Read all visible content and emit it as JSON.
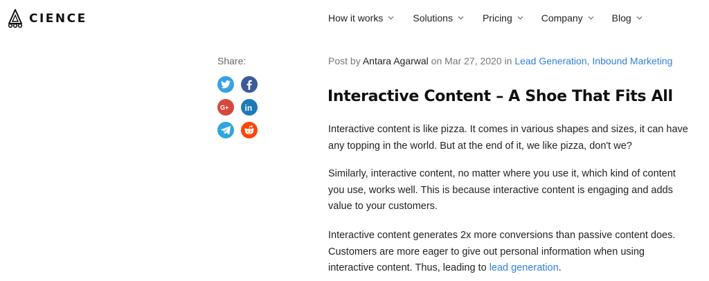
{
  "header": {
    "brand": "CIENCE",
    "nav": [
      {
        "label": "How it works"
      },
      {
        "label": "Solutions"
      },
      {
        "label": "Pricing"
      },
      {
        "label": "Company"
      },
      {
        "label": "Blog"
      }
    ]
  },
  "share": {
    "label": "Share:",
    "buttons": [
      {
        "name": "twitter",
        "color": "#3aa1e2"
      },
      {
        "name": "facebook",
        "color": "#3a5a98"
      },
      {
        "name": "google-plus",
        "color": "#d5493c"
      },
      {
        "name": "linkedin",
        "color": "#1d7ab8"
      },
      {
        "name": "telegram",
        "color": "#30a6dc"
      },
      {
        "name": "reddit",
        "color": "#fe4500"
      }
    ]
  },
  "post": {
    "meta_prefix": "Post by",
    "author": "Antara Agarwal",
    "meta_on": "on Mar 27, 2020 in",
    "category1": "Lead Generation",
    "separator": ",",
    "category2": "Inbound Marketing",
    "title": "Interactive Content – A Shoe That Fits All",
    "paragraph1": "Interactive content is like pizza. It comes in various shapes and sizes, it can have any topping in the world. But at the end of it, we like pizza, don't we?",
    "paragraph2": "Similarly, interactive content, no matter where you use it, which kind of content you use, works well. This is because interactive content is engaging and adds value to your customers.",
    "paragraph3_text": "Interactive content generates 2x more conversions than passive content does. Customers are more eager to give out personal information when using interactive content. Thus, leading to",
    "paragraph3_link": "lead generation",
    "paragraph3_end": "."
  },
  "colors": {
    "link": "#2f7ee0",
    "text": "#222222",
    "muted": "#777777"
  }
}
